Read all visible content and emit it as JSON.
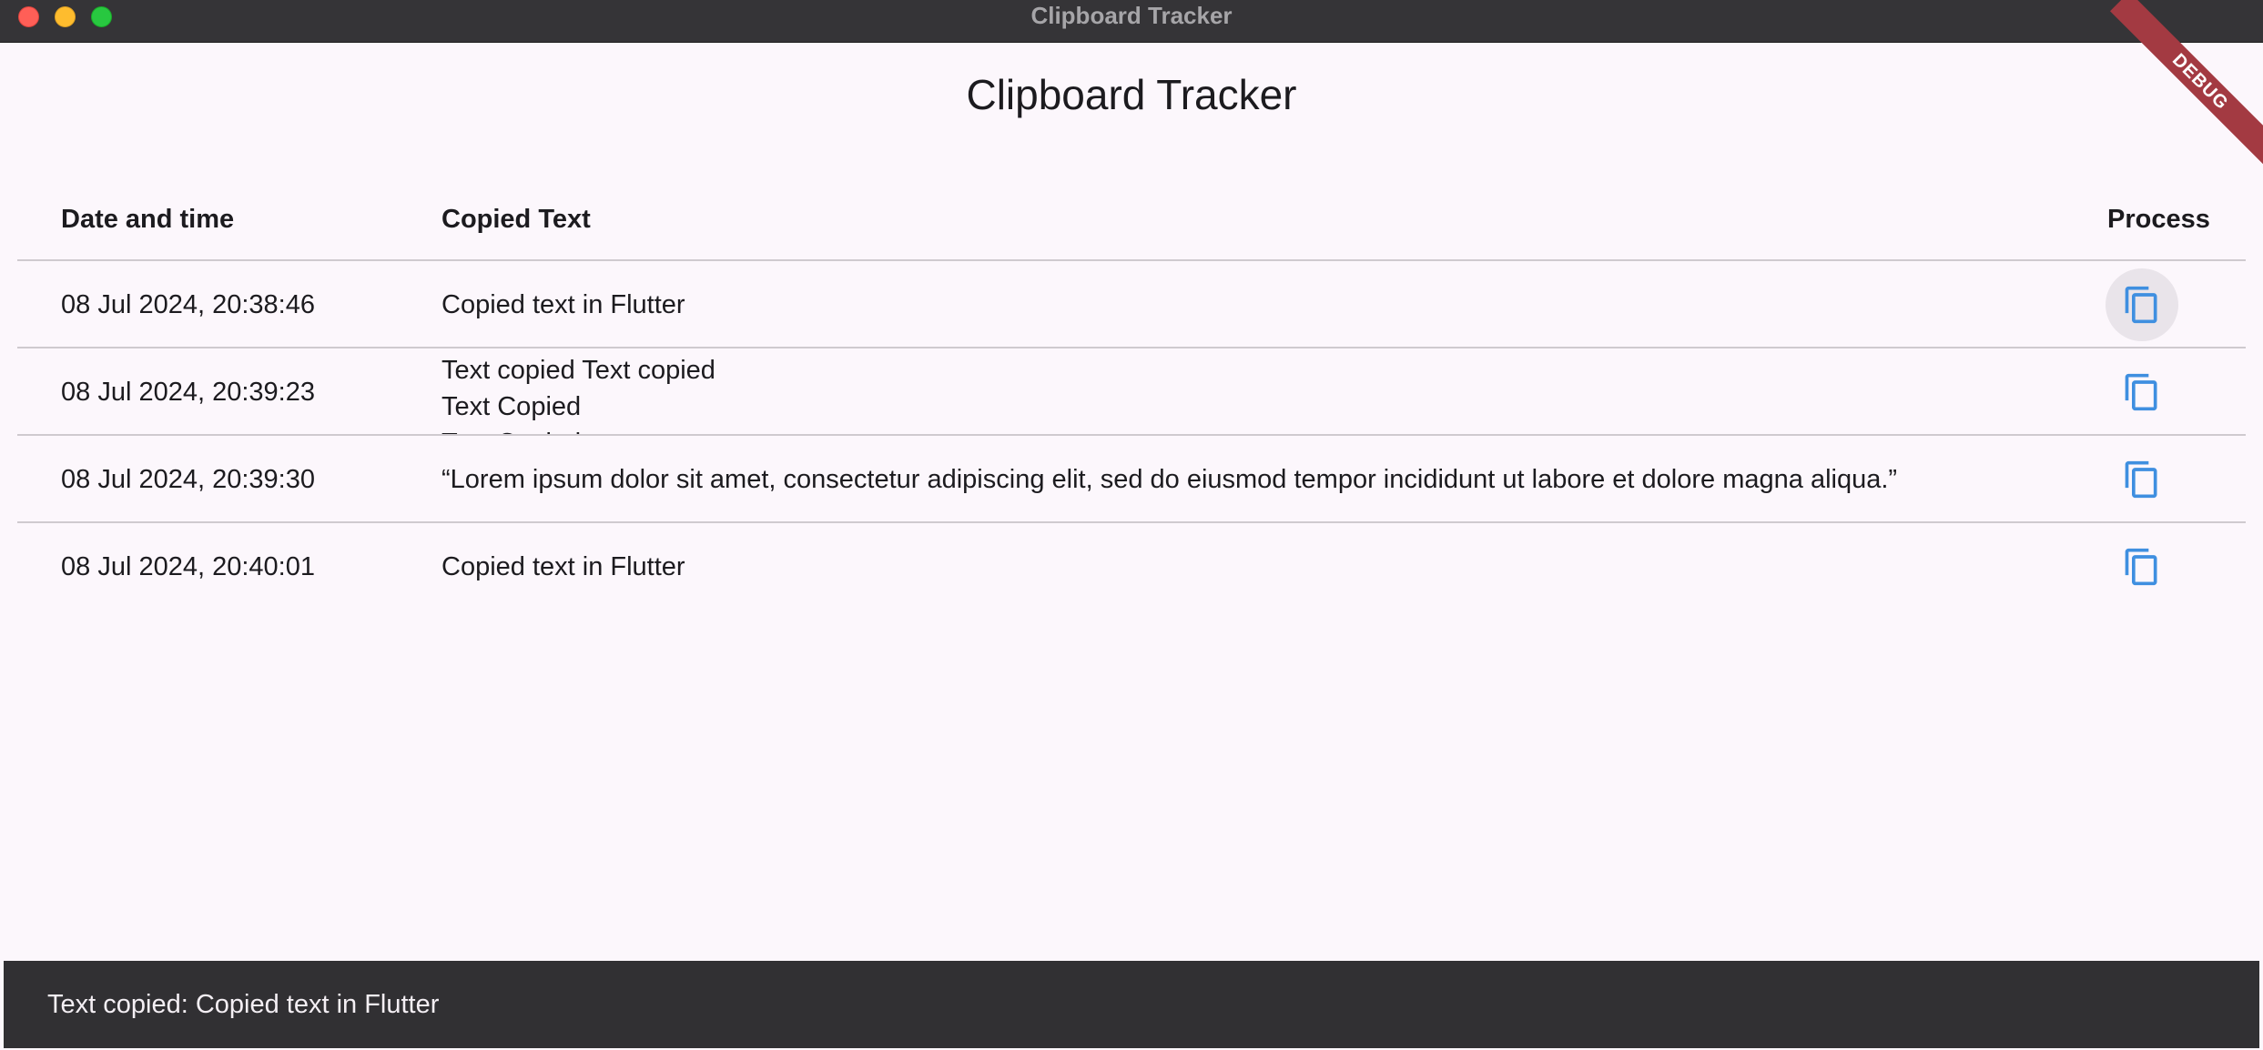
{
  "window": {
    "title": "Clipboard Tracker"
  },
  "app": {
    "title": "Clipboard Tracker",
    "debug_label": "DEBUG"
  },
  "table": {
    "headers": {
      "date": "Date and time",
      "text": "Copied Text",
      "process": "Process"
    },
    "rows": [
      {
        "date": "08 Jul 2024, 20:38:46",
        "text": "Copied text in Flutter",
        "icon": "copy-icon"
      },
      {
        "date": "08 Jul 2024, 20:39:23",
        "text": "Text copied Text copied\nText Copied\nText Copied",
        "icon": "copy-icon"
      },
      {
        "date": "08 Jul 2024, 20:39:30",
        "text": "“Lorem ipsum dolor sit amet, consectetur adipiscing elit, sed do eiusmod tempor incididunt ut labore et dolore magna aliqua.”",
        "icon": "copy-icon"
      },
      {
        "date": "08 Jul 2024, 20:40:01",
        "text": "Copied text in Flutter",
        "icon": "copy-icon"
      }
    ]
  },
  "snackbar": {
    "message": "Text copied: Copied text in Flutter"
  },
  "colors": {
    "accent": "#3f8fe0",
    "background": "#fcf7fc",
    "snackbar": "#313033",
    "divider": "#cfcacf"
  }
}
